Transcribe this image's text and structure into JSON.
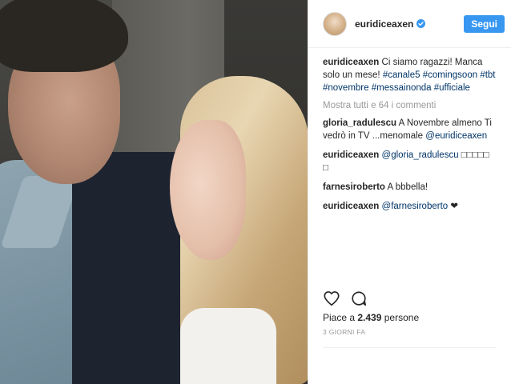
{
  "post": {
    "header": {
      "username": "euridiceaxen",
      "verified_icon": "verified-badge-icon",
      "follow_label": "Segui",
      "accent_color": "#3897f0"
    },
    "caption": {
      "username": "euridiceaxen",
      "text": "Ci siamo ragazzi! Manca solo un mese!",
      "hashtags": [
        "#canale5",
        "#comingsoon",
        "#tbt",
        "#novembre",
        "#messainonda",
        "#ufficiale"
      ]
    },
    "show_all_comments": "Mostra tutti e 64 i commenti",
    "comments": [
      {
        "username": "gloria_radulescu",
        "text": "A Novembre almeno Ti vedrò in TV ...menomale",
        "mention": "@euridiceaxen"
      },
      {
        "username": "euridiceaxen",
        "mention": "@gloria_radulescu",
        "text": "□□□□□ □"
      },
      {
        "username": "farnesiroberto",
        "text": "A bbbella!"
      },
      {
        "username": "euridiceaxen",
        "mention": "@farnesiroberto",
        "text": "❤"
      }
    ],
    "actions": {
      "like_icon": "heart-icon",
      "comment_icon": "comment-bubble-icon"
    },
    "likes_prefix": "Piace a",
    "likes_count": "2.439",
    "likes_suffix": "persone",
    "timestamp": "3 GIORNI FA"
  }
}
